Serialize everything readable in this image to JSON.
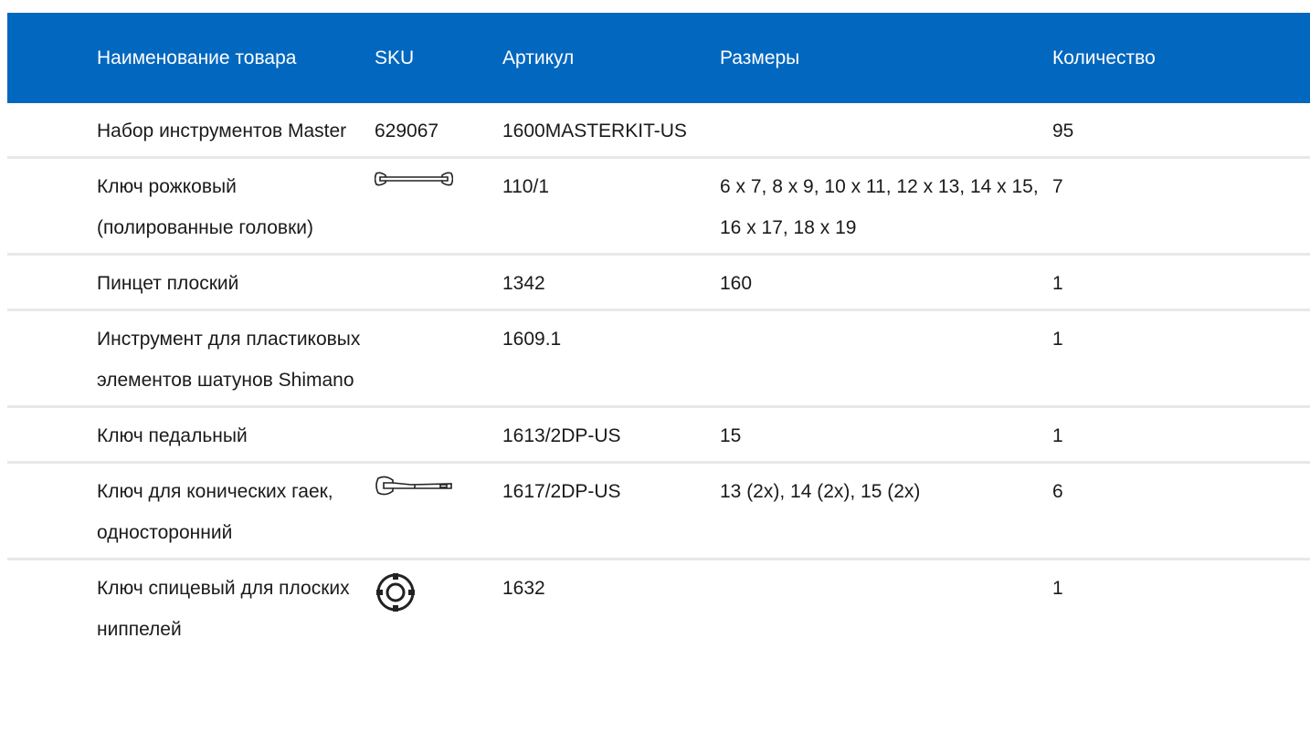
{
  "table": {
    "headers": {
      "name": "Наименование товара",
      "sku": "SKU",
      "article": "Артикул",
      "sizes": "Размеры",
      "quantity": "Количество"
    },
    "rows": [
      {
        "name": "Набор инструментов Master",
        "sku": "629067",
        "sku_icon": "",
        "article": "1600MASTERKIT-US",
        "sizes": "",
        "quantity": "95"
      },
      {
        "name": "Ключ рожковый (полированные головки)",
        "sku": "",
        "sku_icon": "open-end-wrench-icon",
        "article": "110/1",
        "sizes": "6 x 7, 8 x 9, 10 x 11, 12 x 13, 14 x 15, 16 x 17, 18 x 19",
        "quantity": "7"
      },
      {
        "name": "Пинцет плоский",
        "sku": "",
        "sku_icon": "",
        "article": "1342",
        "sizes": "160",
        "quantity": "1"
      },
      {
        "name": "Инструмент для пластиковых элементов шатунов Shimano",
        "sku": "",
        "sku_icon": "",
        "article": "1609.1",
        "sizes": "",
        "quantity": "1"
      },
      {
        "name": "Ключ педальный",
        "sku": "",
        "sku_icon": "",
        "article": "1613/2DP-US",
        "sizes": "15",
        "quantity": "1"
      },
      {
        "name": "Ключ для конических гаек, односторонний",
        "sku": "",
        "sku_icon": "cone-wrench-icon",
        "article": "1617/2DP-US",
        "sizes": "13 (2x), 14 (2x), 15 (2x)",
        "quantity": "6"
      },
      {
        "name": "Ключ спицевый для плоских ниппелей",
        "sku": "",
        "sku_icon": "spoke-wrench-icon",
        "article": "1632",
        "sizes": "",
        "quantity": "1"
      }
    ]
  }
}
